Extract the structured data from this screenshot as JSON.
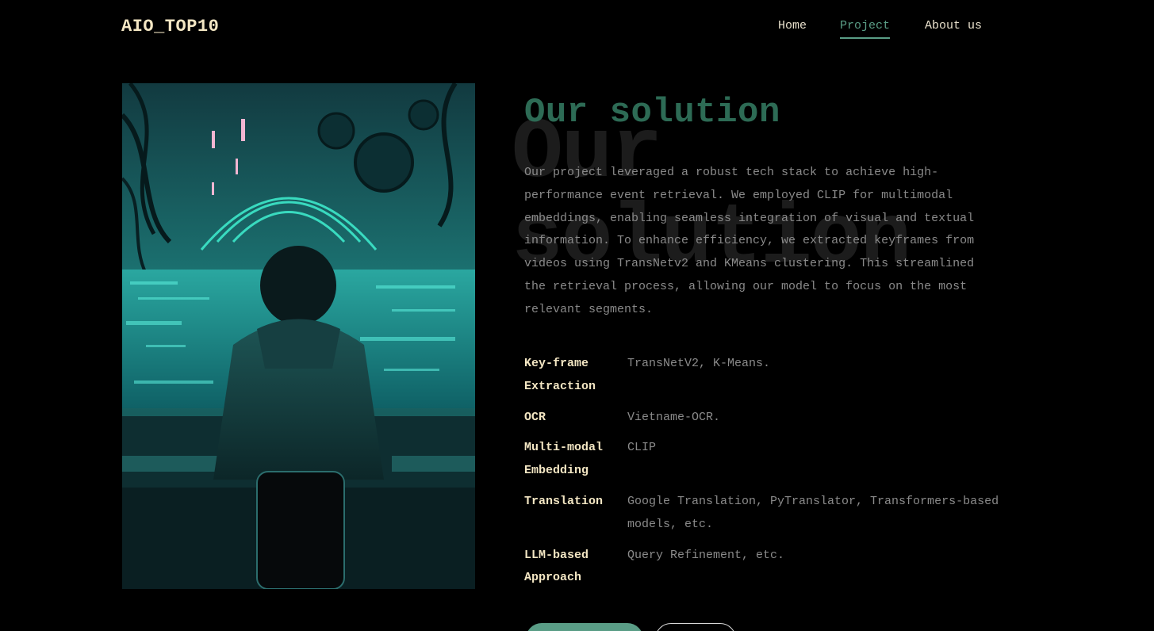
{
  "header": {
    "logo": "AIO_TOP10",
    "nav": [
      {
        "label": "Home",
        "active": false
      },
      {
        "label": "Project",
        "active": true
      },
      {
        "label": "About us",
        "active": false
      }
    ]
  },
  "main": {
    "title": "Our solution",
    "watermark": "Our\nsolution",
    "description": "Our project leveraged a robust tech stack to achieve high-performance event retrieval. We employed CLIP for multimodal embeddings, enabling seamless integration of visual and textual information. To enhance efficiency, we extracted keyframes from videos using TransNetv2 and KMeans clustering. This streamlined the retrieval process, allowing our model to focus on the most relevant segments.",
    "specs": [
      {
        "key": "Key-frame Extraction",
        "value": "TransNetV2, K-Means."
      },
      {
        "key": "OCR",
        "value": "Vietname-OCR."
      },
      {
        "key": "Multi-modal Embedding",
        "value": "CLIP"
      },
      {
        "key": "Translation",
        "value": "Google Translation, PyTranslator, Transformers-based models, etc."
      },
      {
        "key": "LLM-based Approach",
        "value": "Query Refinement, etc."
      }
    ]
  },
  "colors": {
    "background": "#000000",
    "accent": "#5a9d86",
    "title": "#2d6b55",
    "logo": "#f3e6c3",
    "body_text": "#8a8a8a"
  },
  "icons": {
    "hero_image": "hooded-person-at-cyberpunk-monitors-illustration"
  }
}
